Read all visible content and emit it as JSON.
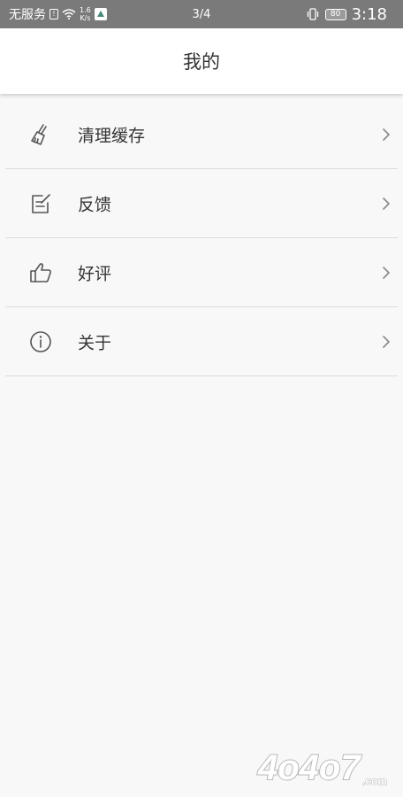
{
  "status_bar": {
    "carrier": "无服务",
    "net_speed_value": "1.6",
    "net_speed_unit": "K/s",
    "page_indicator": "3/4",
    "battery": "80",
    "time": "3:18"
  },
  "header": {
    "title": "我的"
  },
  "menu": {
    "items": [
      {
        "label": "清理缓存",
        "icon": "broom-icon"
      },
      {
        "label": "反馈",
        "icon": "edit-note-icon"
      },
      {
        "label": "好评",
        "icon": "thumbs-up-icon"
      },
      {
        "label": "关于",
        "icon": "info-icon"
      }
    ]
  },
  "watermark": {
    "text": "4o4o7",
    "suffix": ".com"
  }
}
